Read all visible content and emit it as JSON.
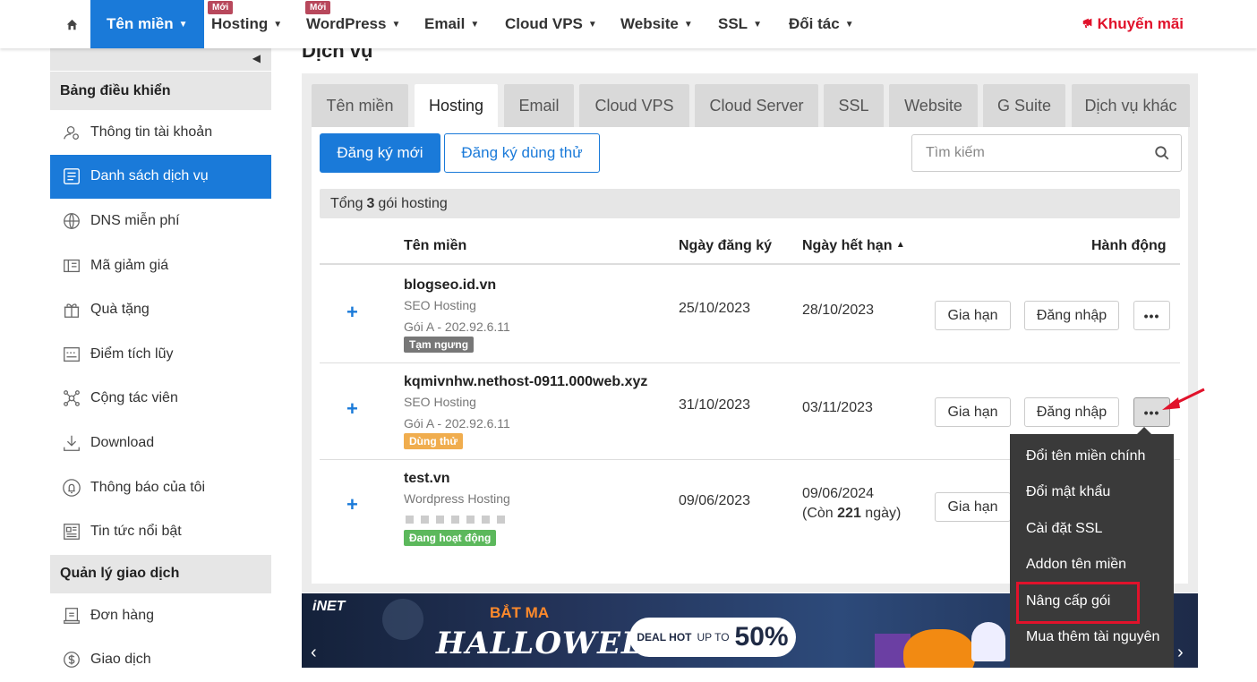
{
  "topnav": {
    "items": [
      {
        "label": "Tên miền",
        "active": true,
        "badge": ""
      },
      {
        "label": "Hosting",
        "badge": "Mới"
      },
      {
        "label": "WordPress",
        "badge": "Mới"
      },
      {
        "label": "Email",
        "badge": ""
      },
      {
        "label": "Cloud VPS",
        "badge": ""
      },
      {
        "label": "Website",
        "badge": ""
      },
      {
        "label": "SSL",
        "badge": ""
      },
      {
        "label": "Đối tác",
        "badge": ""
      }
    ],
    "promo": "Khuyến mãi",
    "promo_icon": "megaphone-icon",
    "accent": "#1a7ad9",
    "promo_color": "#e1122b"
  },
  "sidebar": {
    "section1": "Bảng điều khiển",
    "items": [
      {
        "label": "Thông tin tài khoản",
        "icon": "user-settings-icon"
      },
      {
        "label": "Danh sách dịch vụ",
        "icon": "list-icon",
        "active": true
      },
      {
        "label": "DNS miễn phí",
        "icon": "globe-icon"
      },
      {
        "label": "Mã giảm giá",
        "icon": "coupon-icon"
      },
      {
        "label": "Quà tặng",
        "icon": "gift-icon"
      },
      {
        "label": "Điểm tích lũy",
        "icon": "points-icon"
      },
      {
        "label": "Cộng tác viên",
        "icon": "network-icon"
      },
      {
        "label": "Download",
        "icon": "download-icon"
      },
      {
        "label": "Thông báo của tôi",
        "icon": "bell-icon"
      },
      {
        "label": "Tin tức nổi bật",
        "icon": "news-icon"
      }
    ],
    "section2": "Quản lý giao dịch",
    "items2": [
      {
        "label": "Đơn hàng",
        "icon": "invoice-icon"
      },
      {
        "label": "Giao dịch",
        "icon": "money-icon"
      }
    ]
  },
  "page": {
    "title": "Dịch vụ",
    "tabs": [
      "Tên miền",
      "Hosting",
      "Email",
      "Cloud VPS",
      "Cloud Server",
      "SSL",
      "Website",
      "G Suite",
      "Dịch vụ khác"
    ],
    "active_tab": "Hosting",
    "register_new": "Đăng ký mới",
    "register_trial": "Đăng ký dùng thử",
    "search_placeholder": "Tìm kiếm",
    "summary_prefix": "Tổng",
    "summary_count": "3",
    "summary_suffix": "gói hosting"
  },
  "table": {
    "headers": {
      "domain": "Tên miền",
      "reg_date": "Ngày đăng ký",
      "exp_date": "Ngày hết hạn",
      "actions": "Hành động"
    },
    "renew_label": "Gia hạn",
    "login_label": "Đăng nhập",
    "more_label": "•••",
    "rows": [
      {
        "domain": "blogseo.id.vn",
        "type": "SEO Hosting",
        "package": "Gói A - 202.92.6.11",
        "status": "Tạm ngưng",
        "status_color": "#777777",
        "reg_date": "25/10/2023",
        "exp_date": "28/10/2023",
        "remaining_prefix": "",
        "remaining_days": "",
        "remaining_suffix": ""
      },
      {
        "domain": "kqmivnhw.nethost-0911.000web.xyz",
        "type": "SEO Hosting",
        "package": "Gói A - 202.92.6.11",
        "status": "Dùng thử",
        "status_color": "#f0ad4e",
        "reg_date": "31/10/2023",
        "exp_date": "03/11/2023",
        "remaining_prefix": "",
        "remaining_days": "",
        "remaining_suffix": ""
      },
      {
        "domain": "test.vn",
        "type": "Wordpress Hosting",
        "package": "",
        "status": "Đang hoạt động",
        "status_color": "#5cb85c",
        "reg_date": "09/06/2023",
        "exp_date": "09/06/2024",
        "remaining_prefix": "(Còn",
        "remaining_days": "221",
        "remaining_suffix": "ngày)"
      }
    ]
  },
  "dropdown": {
    "items": [
      "Đổi tên miền chính",
      "Đổi mật khẩu",
      "Cài đặt SSL",
      "Addon tên miền",
      "Nâng cấp gói",
      "Mua thêm tài nguyên"
    ],
    "highlighted": "Nâng cấp gói"
  },
  "banner": {
    "logo": "iNET",
    "title1": "BẮT MA",
    "title2": "HALLOWEEN",
    "deal_prefix": "DEAL HOT",
    "deal_upto": "UP TO",
    "deal_value": "50%"
  }
}
